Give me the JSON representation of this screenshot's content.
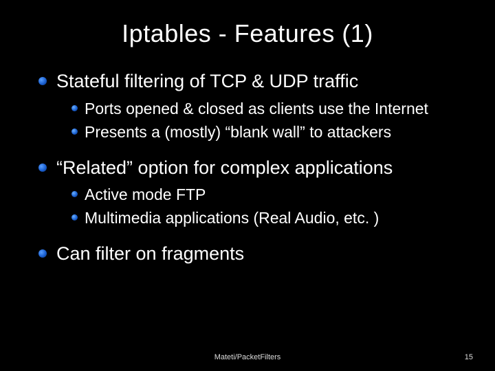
{
  "title": "Iptables - Features (1)",
  "bullets": [
    {
      "text": "Stateful filtering of TCP & UDP traffic",
      "sub": [
        "Ports opened & closed as clients use the Internet",
        "Presents a (mostly) “blank wall” to attackers"
      ]
    },
    {
      "text": "“Related” option for complex applications",
      "sub": [
        "Active mode FTP",
        "Multimedia applications (Real Audio, etc. )"
      ]
    },
    {
      "text": "Can filter on fragments",
      "sub": []
    }
  ],
  "footer": {
    "center": "Mateti/PacketFilters",
    "page": "15"
  }
}
